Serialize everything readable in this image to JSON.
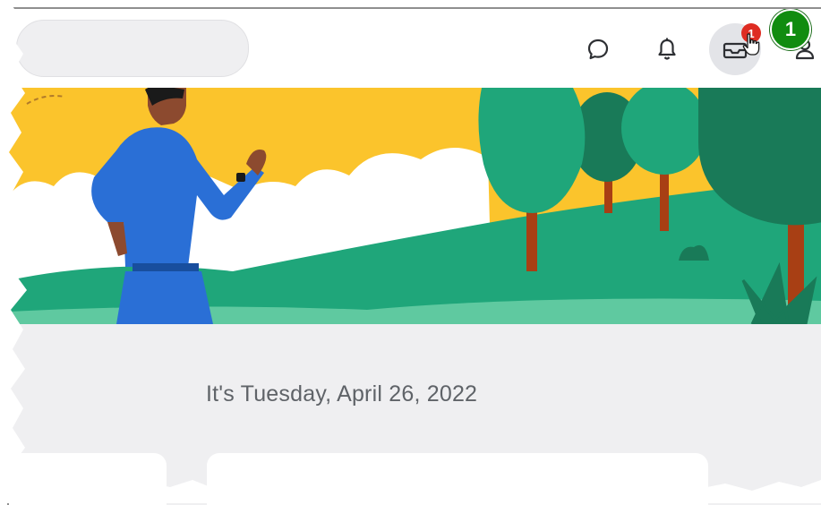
{
  "header": {
    "search_placeholder": "",
    "inbox_badge_count": "1",
    "icons": [
      "chat-icon",
      "bell-icon",
      "inbox-icon",
      "profile-icon"
    ]
  },
  "annotation": {
    "step_number": "1"
  },
  "main": {
    "date_text": "It's Tuesday, April 26, 2022"
  },
  "colors": {
    "accent_badge": "#de2c22",
    "step_marker": "#118c10",
    "sky": "#fbc42c",
    "grass_light": "#1fa67a",
    "tree_green": "#1b8a62",
    "figure_blue": "#2a6fd6"
  }
}
